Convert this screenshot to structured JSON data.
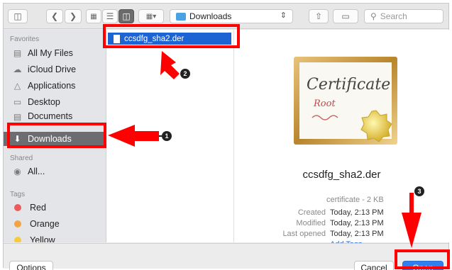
{
  "toolbar": {
    "folder_name": "Downloads",
    "search_placeholder": "Search"
  },
  "sidebar": {
    "favorites_header": "Favorites",
    "favorites": [
      {
        "label": "All My Files"
      },
      {
        "label": "iCloud Drive"
      },
      {
        "label": "Applications"
      },
      {
        "label": "Desktop"
      },
      {
        "label": "Documents"
      },
      {
        "label": "Downloads",
        "selected": true
      }
    ],
    "shared_header": "Shared",
    "shared": [
      {
        "label": "All..."
      }
    ],
    "tags_header": "Tags",
    "tags": [
      {
        "label": "Red",
        "color": "#ec5b5b"
      },
      {
        "label": "Orange",
        "color": "#f4a342"
      },
      {
        "label": "Yellow",
        "color": "#f5cd3b"
      }
    ]
  },
  "file_list": {
    "selected_file": "ccsdfg_sha2.der"
  },
  "preview": {
    "certificate_text": "Certificate",
    "certificate_sub": "Root",
    "file_name": "ccsdfg_sha2.der",
    "kind": "certificate - 2 KB",
    "created_label": "Created",
    "created_value": "Today, 2:13 PM",
    "modified_label": "Modified",
    "modified_value": "Today, 2:13 PM",
    "last_opened_label": "Last opened",
    "last_opened_value": "Today, 2:13 PM",
    "add_tags": "Add Tags..."
  },
  "bottom_bar": {
    "options_label": "Options",
    "cancel_label": "Cancel",
    "open_label": "Open"
  },
  "annotations": {
    "step1": "1",
    "step2": "2",
    "step3": "3",
    "highlight_color": "#ff0000"
  }
}
